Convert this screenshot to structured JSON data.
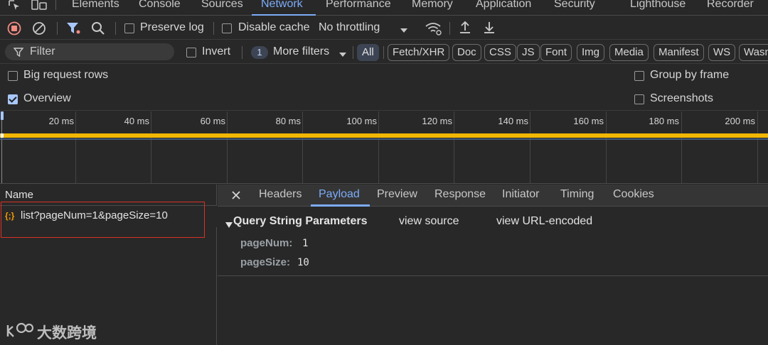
{
  "tabs": [
    "Elements",
    "Console",
    "Sources",
    "Network",
    "Performance",
    "Memory",
    "Application",
    "Security",
    "Lighthouse",
    "Recorder"
  ],
  "active_tab": "Network",
  "toolbar": {
    "preserve_log": "Preserve log",
    "disable_cache": "Disable cache",
    "throttling": "No throttling"
  },
  "filter": {
    "placeholder": "Filter",
    "invert": "Invert",
    "more_filters_count": "1",
    "more_filters": "More filters",
    "types": [
      "All",
      "Fetch/XHR",
      "Doc",
      "CSS",
      "JS",
      "Font",
      "Img",
      "Media",
      "Manifest",
      "WS",
      "Wasm"
    ]
  },
  "options": {
    "big_request_rows": "Big request rows",
    "overview": "Overview",
    "group_by_frame": "Group by frame",
    "screenshots": "Screenshots"
  },
  "timeline": {
    "ticks": [
      "20 ms",
      "40 ms",
      "60 ms",
      "80 ms",
      "100 ms",
      "120 ms",
      "140 ms",
      "160 ms",
      "180 ms",
      "200 ms"
    ]
  },
  "request_list": {
    "column_name": "Name",
    "requests": [
      {
        "icon": "{;}",
        "name": "list?pageNum=1&pageSize=10"
      }
    ]
  },
  "detail_tabs": [
    "Headers",
    "Payload",
    "Preview",
    "Response",
    "Initiator",
    "Timing",
    "Cookies"
  ],
  "active_detail_tab": "Payload",
  "payload": {
    "section_title": "Query String Parameters",
    "view_source": "view source",
    "view_url_encoded": "view URL-encoded",
    "params": [
      {
        "key": "pageNum:",
        "value": "1"
      },
      {
        "key": "pageSize:",
        "value": "10"
      }
    ]
  },
  "watermark": "大数跨境",
  "colors": {
    "accent": "#7cacf8",
    "highlight_box": "#d93025",
    "record_stop": "#f28b82",
    "waterfall_bar": "#f2b705"
  }
}
